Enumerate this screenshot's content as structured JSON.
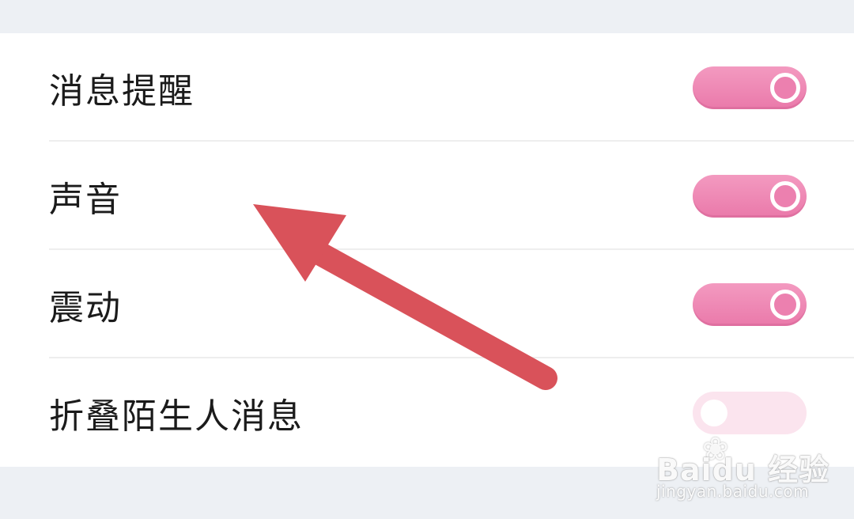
{
  "settings": {
    "items": [
      {
        "label": "消息提醒",
        "enabled": true
      },
      {
        "label": "声音",
        "enabled": true
      },
      {
        "label": "震动",
        "enabled": true
      },
      {
        "label": "折叠陌生人消息",
        "enabled": false
      }
    ]
  },
  "colors": {
    "toggle_on": "#ec80af",
    "toggle_off": "#fbe4ee",
    "arrow": "#d9525a",
    "background": "#edf0f4"
  },
  "annotation": {
    "arrow_icon": "arrow-up-left-icon"
  },
  "watermark": {
    "brand": "Bai",
    "brand_suffix": "du 经验",
    "url": "jingyan.baidu.com",
    "paw_icon": "paw-icon"
  }
}
